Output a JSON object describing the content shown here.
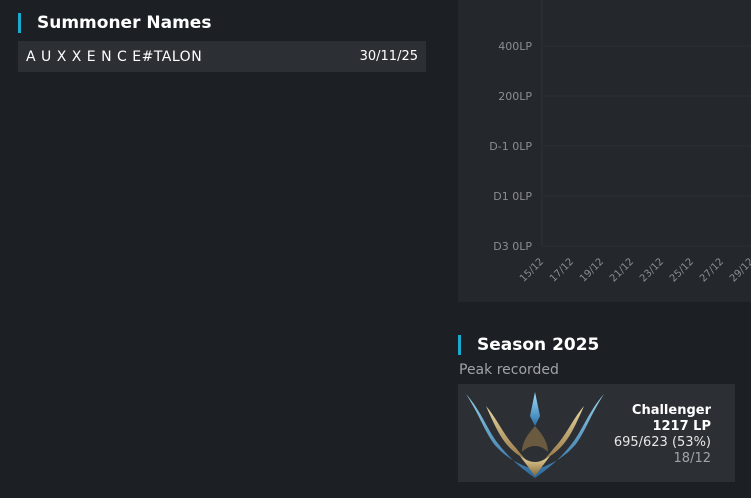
{
  "summoner_names": {
    "title": "Summoner Names",
    "items": [
      {
        "name": "A U X X E N C E#TALON",
        "date": "30/11/25"
      }
    ]
  },
  "chart_data": {
    "type": "line",
    "y_ticks": [
      "400LP",
      "200LP",
      "D-1 0LP",
      "D1 0LP",
      "D3 0LP"
    ],
    "x_ticks": [
      "15/12",
      "17/12",
      "19/12",
      "21/12",
      "23/12",
      "25/12",
      "27/12",
      "29/12"
    ],
    "grid": true,
    "series": []
  },
  "season": {
    "title": "Season 2025",
    "subtitle": "Peak recorded",
    "tier": "Challenger",
    "lp": "1217 LP",
    "record": "695/623 (53%)",
    "date": "18/12",
    "emblem_icon": "challenger-emblem-icon"
  },
  "colors": {
    "accent": "#1ba9cf",
    "background": "#1c1f24",
    "panel": "#24272c",
    "row": "#2c2f34"
  }
}
